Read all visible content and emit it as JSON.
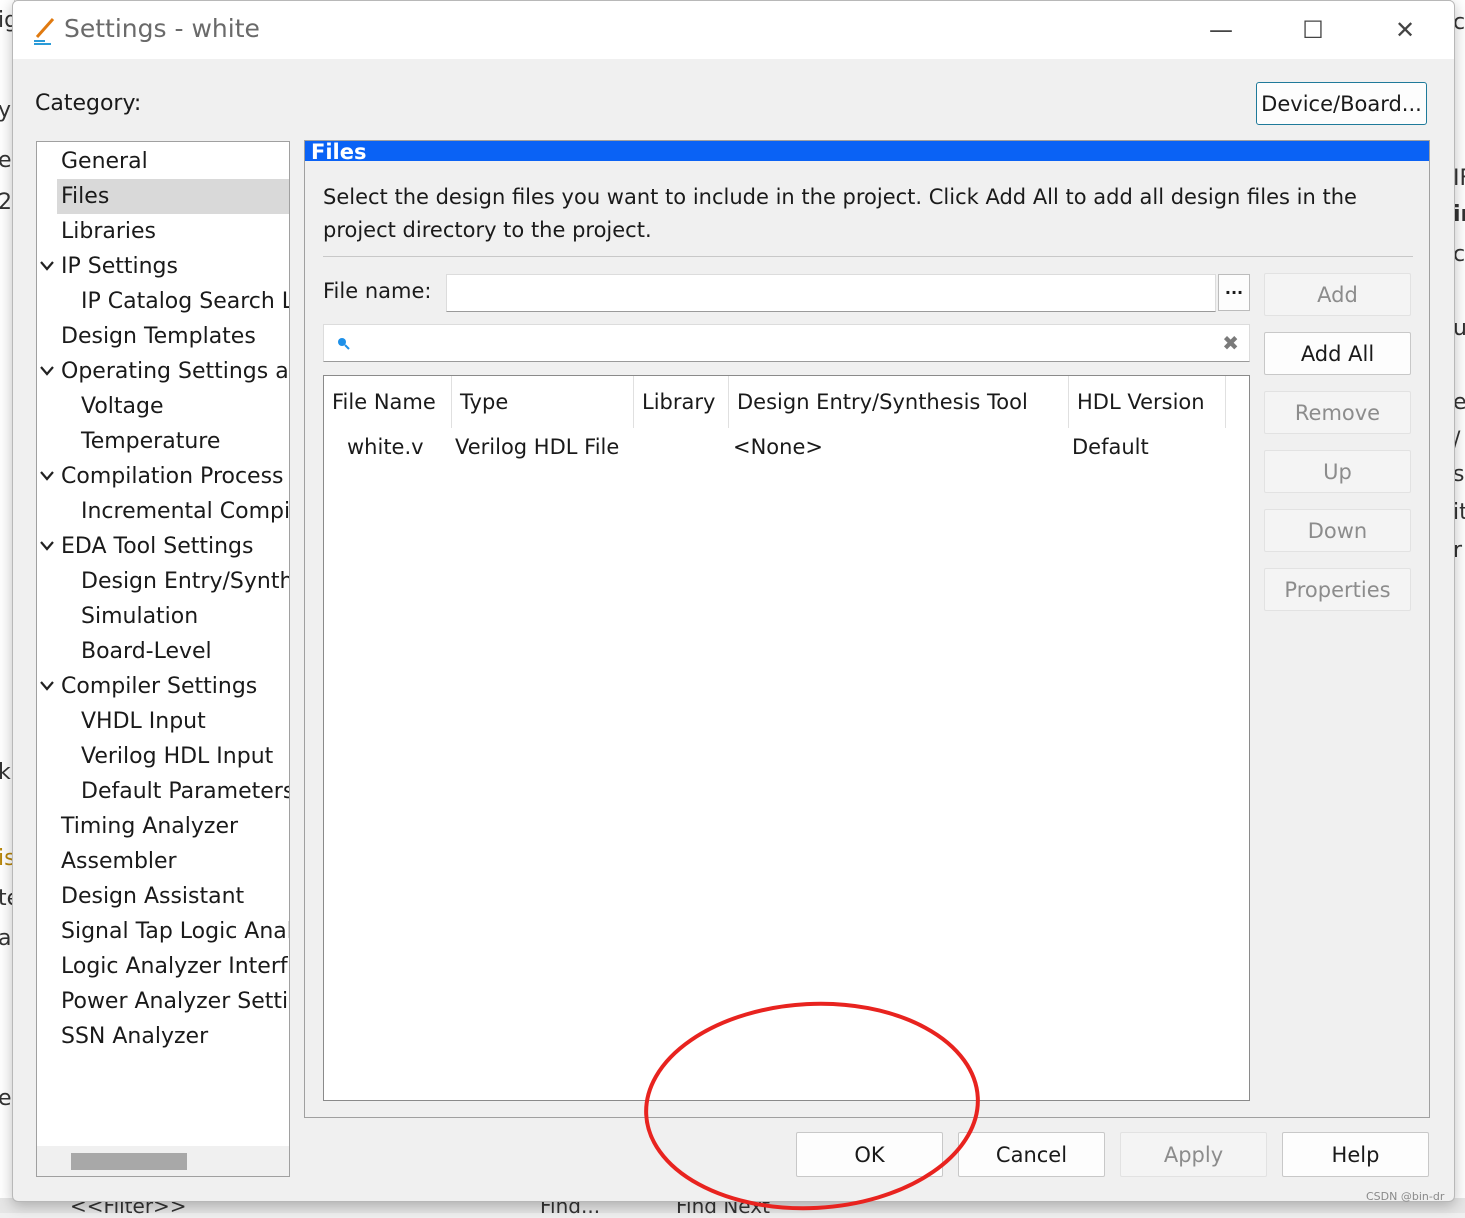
{
  "window": {
    "title": "Settings - white",
    "minimize_glyph": "—",
    "maximize_glyph": "☐",
    "close_glyph": "✕"
  },
  "category_label": "Category:",
  "device_button": "Device/Board...",
  "tree": {
    "items": [
      {
        "label": "General",
        "indent": 0,
        "expandable": false,
        "selected": false
      },
      {
        "label": "Files",
        "indent": 0,
        "expandable": false,
        "selected": true
      },
      {
        "label": "Libraries",
        "indent": 0,
        "expandable": false,
        "selected": false
      },
      {
        "label": "IP Settings",
        "indent": 0,
        "expandable": true,
        "selected": false
      },
      {
        "label": "IP Catalog Search Locations",
        "indent": 1,
        "expandable": false,
        "selected": false
      },
      {
        "label": "Design Templates",
        "indent": 0,
        "expandable": false,
        "selected": false
      },
      {
        "label": "Operating Settings and Conditions",
        "indent": 0,
        "expandable": true,
        "selected": false
      },
      {
        "label": "Voltage",
        "indent": 1,
        "expandable": false,
        "selected": false
      },
      {
        "label": "Temperature",
        "indent": 1,
        "expandable": false,
        "selected": false
      },
      {
        "label": "Compilation Process Settings",
        "indent": 0,
        "expandable": true,
        "selected": false
      },
      {
        "label": "Incremental Compilation",
        "indent": 1,
        "expandable": false,
        "selected": false
      },
      {
        "label": "EDA Tool Settings",
        "indent": 0,
        "expandable": true,
        "selected": false
      },
      {
        "label": "Design Entry/Synthesis",
        "indent": 1,
        "expandable": false,
        "selected": false
      },
      {
        "label": "Simulation",
        "indent": 1,
        "expandable": false,
        "selected": false
      },
      {
        "label": "Board-Level",
        "indent": 1,
        "expandable": false,
        "selected": false
      },
      {
        "label": "Compiler Settings",
        "indent": 0,
        "expandable": true,
        "selected": false
      },
      {
        "label": "VHDL Input",
        "indent": 1,
        "expandable": false,
        "selected": false
      },
      {
        "label": "Verilog HDL Input",
        "indent": 1,
        "expandable": false,
        "selected": false
      },
      {
        "label": "Default Parameters",
        "indent": 1,
        "expandable": false,
        "selected": false
      },
      {
        "label": "Timing Analyzer",
        "indent": 0,
        "expandable": false,
        "selected": false
      },
      {
        "label": "Assembler",
        "indent": 0,
        "expandable": false,
        "selected": false
      },
      {
        "label": "Design Assistant",
        "indent": 0,
        "expandable": false,
        "selected": false
      },
      {
        "label": "Signal Tap Logic Analyzer",
        "indent": 0,
        "expandable": false,
        "selected": false
      },
      {
        "label": "Logic Analyzer Interface",
        "indent": 0,
        "expandable": false,
        "selected": false
      },
      {
        "label": "Power Analyzer Settings",
        "indent": 0,
        "expandable": false,
        "selected": false
      },
      {
        "label": "SSN Analyzer",
        "indent": 0,
        "expandable": false,
        "selected": false
      }
    ]
  },
  "panel": {
    "header": "Files",
    "description": "Select the design files you want to include in the project. Click Add All to add all design files in the project directory to the project.",
    "file_name_label": "File name:",
    "file_name_value": "",
    "browse_label": "...",
    "search_value": "",
    "search_clear_glyph": "✖",
    "table": {
      "columns": [
        "File Name",
        "Type",
        "Library",
        "Design Entry/Synthesis Tool",
        "HDL Version"
      ],
      "rows": [
        [
          "white.v",
          "Verilog HDL File",
          "",
          "<None>",
          "Default"
        ]
      ]
    },
    "side_buttons": [
      {
        "label": "Add",
        "enabled": false
      },
      {
        "label": "Add All",
        "enabled": true
      },
      {
        "label": "Remove",
        "enabled": false
      },
      {
        "label": "Up",
        "enabled": false
      },
      {
        "label": "Down",
        "enabled": false
      },
      {
        "label": "Properties",
        "enabled": false
      }
    ]
  },
  "footer_buttons": [
    {
      "label": "OK",
      "enabled": true
    },
    {
      "label": "Cancel",
      "enabled": true
    },
    {
      "label": "Apply",
      "enabled": false
    },
    {
      "label": "Help",
      "enabled": true
    }
  ],
  "annotation": {
    "color": "#e8231f"
  },
  "background": {
    "left_fragments": [
      "ig",
      "y",
      "e",
      "2",
      "k",
      "is",
      "te",
      "at",
      "er"
    ],
    "right_fragments": [
      "cl",
      "IF",
      "ir",
      "c",
      "ur",
      "e",
      "/",
      "sc",
      "it",
      "r"
    ],
    "bottom_fragments": [
      "<<Filter>>",
      "Find...",
      "Find Next"
    ]
  },
  "watermark": "CSDN @bin-dr"
}
